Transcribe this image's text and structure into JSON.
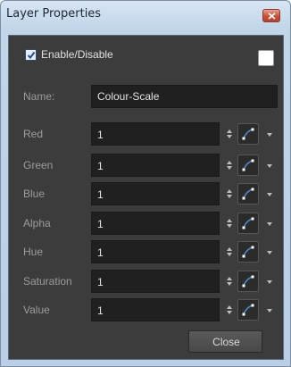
{
  "window": {
    "title": "Layer Properties",
    "close_icon": "close-icon"
  },
  "enable": {
    "label": "Enable/Disable",
    "checked": true
  },
  "swatch_color": "#ffffff",
  "name": {
    "label": "Name:",
    "value": "Colour-Scale"
  },
  "params": [
    {
      "label": "Red",
      "value": "1"
    },
    {
      "label": "Green",
      "value": "1"
    },
    {
      "label": "Blue",
      "value": "1"
    },
    {
      "label": "Alpha",
      "value": "1"
    },
    {
      "label": "Hue",
      "value": "1"
    },
    {
      "label": "Saturation",
      "value": "1"
    },
    {
      "label": "Value",
      "value": "1"
    }
  ],
  "buttons": {
    "close_label": "Close"
  }
}
